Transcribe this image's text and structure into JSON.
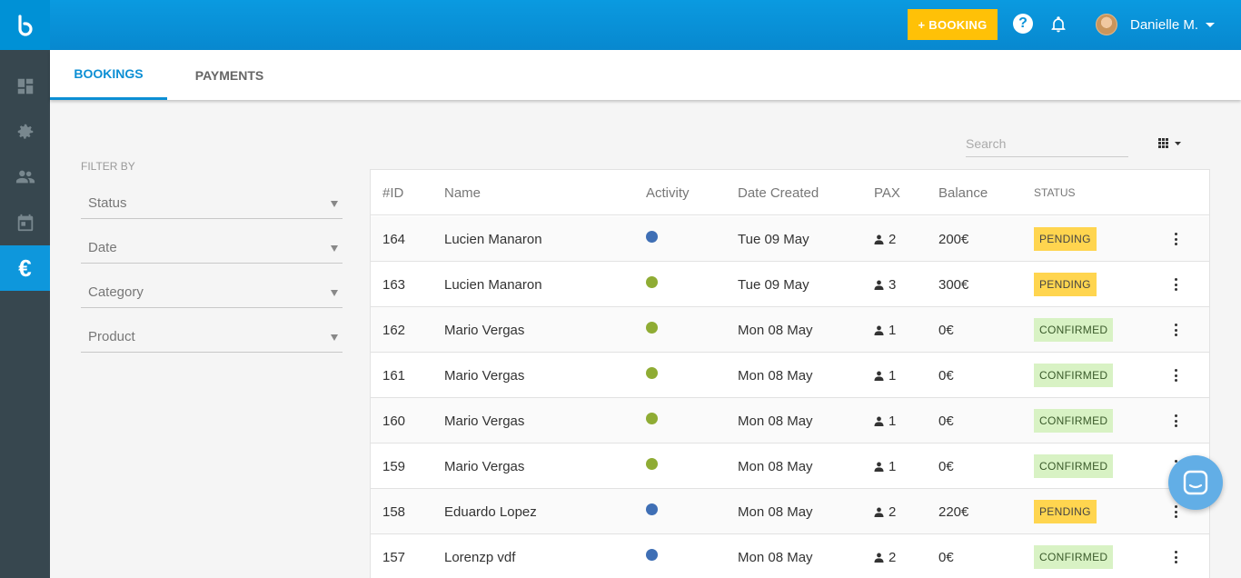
{
  "header": {
    "booking_button_label": "+ BOOKING",
    "user_name": "Danielle M.",
    "brand_color": "#0a93da",
    "accent_color": "#ffc107"
  },
  "sidebar": {
    "logo_icon": "b-logo-icon",
    "items": [
      {
        "icon": "dashboard-icon",
        "active": false
      },
      {
        "icon": "gear-icon",
        "active": false
      },
      {
        "icon": "people-icon",
        "active": false
      },
      {
        "icon": "calendar-icon",
        "active": false
      },
      {
        "icon": "euro-icon",
        "active": true
      }
    ]
  },
  "tabs": [
    {
      "label": "BOOKINGS",
      "active": true
    },
    {
      "label": "PAYMENTS",
      "active": false
    }
  ],
  "filters": {
    "title": "FILTER BY",
    "items": [
      "Status",
      "Date",
      "Category",
      "Product"
    ]
  },
  "search": {
    "placeholder": "Search",
    "value": ""
  },
  "table": {
    "headers": {
      "id": "#ID",
      "name": "Name",
      "activity": "Activity",
      "date": "Date Created",
      "pax": "PAX",
      "balance": "Balance",
      "status": "STATUS"
    },
    "rows": [
      {
        "id": "164",
        "name": "Lucien Manaron",
        "activity_color": "#3f6fb5",
        "date": "Tue 09 May",
        "pax": "2",
        "balance": "200€",
        "status": "PENDING"
      },
      {
        "id": "163",
        "name": "Lucien Manaron",
        "activity_color": "#8fac34",
        "date": "Tue 09 May",
        "pax": "3",
        "balance": "300€",
        "status": "PENDING"
      },
      {
        "id": "162",
        "name": "Mario Vergas",
        "activity_color": "#8fac34",
        "date": "Mon 08 May",
        "pax": "1",
        "balance": "0€",
        "status": "CONFIRMED"
      },
      {
        "id": "161",
        "name": "Mario Vergas",
        "activity_color": "#8fac34",
        "date": "Mon 08 May",
        "pax": "1",
        "balance": "0€",
        "status": "CONFIRMED"
      },
      {
        "id": "160",
        "name": "Mario Vergas",
        "activity_color": "#8fac34",
        "date": "Mon 08 May",
        "pax": "1",
        "balance": "0€",
        "status": "CONFIRMED"
      },
      {
        "id": "159",
        "name": "Mario Vergas",
        "activity_color": "#8fac34",
        "date": "Mon 08 May",
        "pax": "1",
        "balance": "0€",
        "status": "CONFIRMED"
      },
      {
        "id": "158",
        "name": "Eduardo Lopez",
        "activity_color": "#3f6fb5",
        "date": "Mon 08 May",
        "pax": "2",
        "balance": "220€",
        "status": "PENDING"
      },
      {
        "id": "157",
        "name": "Lorenzp vdf",
        "activity_color": "#3f6fb5",
        "date": "Mon 08 May",
        "pax": "2",
        "balance": "0€",
        "status": "CONFIRMED"
      }
    ]
  }
}
